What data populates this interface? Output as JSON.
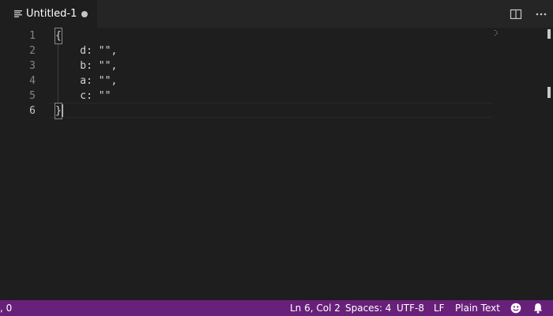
{
  "tab": {
    "title": "Untitled-1",
    "dirty": true,
    "actions": [
      "split-editor",
      "more-actions"
    ]
  },
  "editor": {
    "line_numbers": [
      "1",
      "2",
      "3",
      "4",
      "5",
      "6"
    ],
    "lines": [
      "{",
      "    d: \"\",",
      "    b: \"\",",
      "    a: \"\",",
      "    c: \"\"",
      "}"
    ],
    "active_line": 6
  },
  "statusbar": {
    "left": ", 0",
    "position": "Ln 6, Col 2",
    "indentation": "Spaces: 4",
    "encoding": "UTF-8",
    "eol": "LF",
    "language": "Plain Text",
    "icons": [
      "feedback-smiley-icon",
      "notifications-bell-icon"
    ],
    "background": "#68217a"
  }
}
